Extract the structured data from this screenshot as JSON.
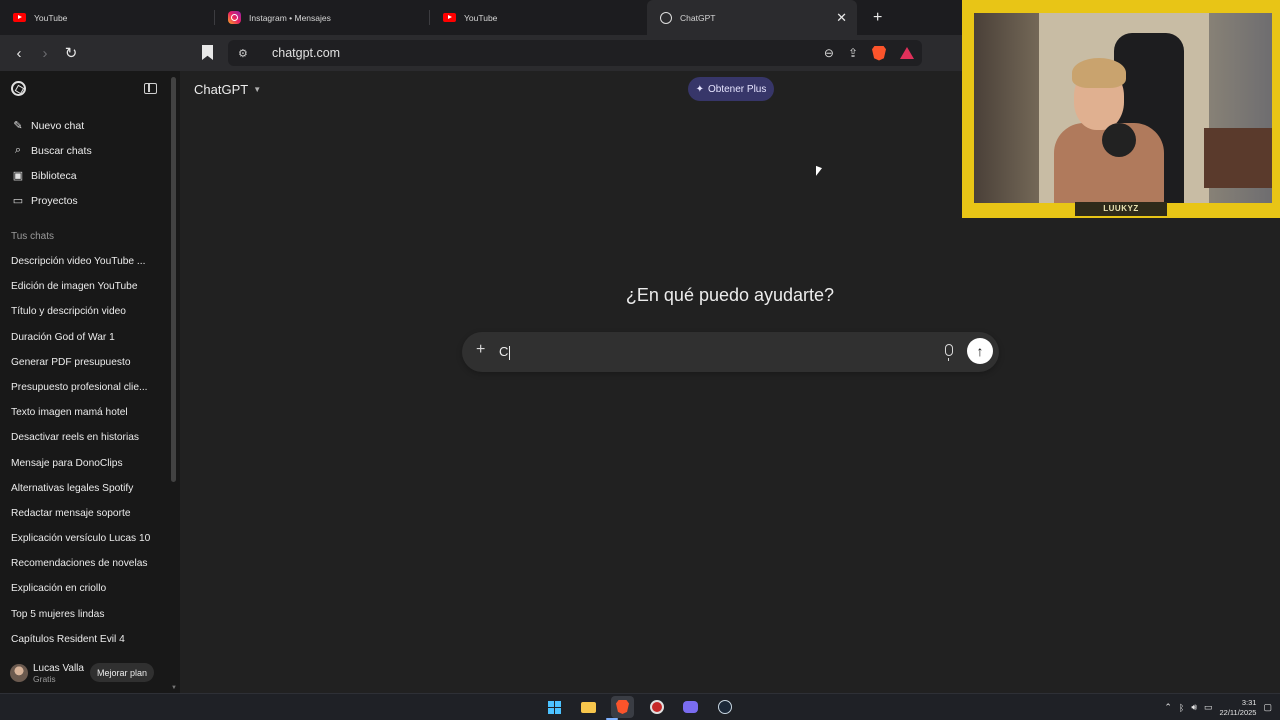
{
  "browser": {
    "tabs": [
      {
        "title": "YouTube",
        "icon": "youtube-icon"
      },
      {
        "title": "Instagram • Mensajes",
        "icon": "instagram-icon"
      },
      {
        "title": "YouTube",
        "icon": "youtube-icon"
      },
      {
        "title": "ChatGPT",
        "icon": "chatgpt-icon",
        "active": true
      }
    ],
    "url": "chatgpt.com"
  },
  "sidebar": {
    "menu": [
      {
        "label": "Nuevo chat",
        "icon": "edit-icon"
      },
      {
        "label": "Buscar chats",
        "icon": "search-icon"
      },
      {
        "label": "Biblioteca",
        "icon": "library-icon"
      },
      {
        "label": "Proyectos",
        "icon": "folder-icon"
      }
    ],
    "section_title": "Tus chats",
    "chats": [
      "Descripción video YouTube ...",
      "Edición de imagen YouTube",
      "Título y descripción video",
      "Duración God of War 1",
      "Generar PDF presupuesto",
      "Presupuesto profesional clie...",
      "Texto imagen mamá hotel",
      "Desactivar reels en historias",
      "Mensaje para DonoClips",
      "Alternativas legales Spotify",
      "Redactar mensaje soporte",
      "Explicación versículo Lucas 10",
      "Recomendaciones de novelas",
      "Explicación en criollo",
      "Top 5 mujeres lindas",
      "Capítulos Resident Evil 4"
    ],
    "user": {
      "name": "Lucas Valla",
      "plan": "Gratis",
      "upgrade_label": "Mejorar plan"
    }
  },
  "main": {
    "model_label": "ChatGPT",
    "plus_label": "Obtener Plus",
    "headline": "¿En qué puedo ayudarte?",
    "composer_text": "C"
  },
  "webcam": {
    "label": "LUUKYZ"
  },
  "taskbar": {
    "time": "3:31",
    "date": "22/11/2025"
  },
  "colors": {
    "plus_button": "#373669",
    "webcam_border": "#e8c516",
    "sidebar_bg": "#181818",
    "main_bg": "#212121"
  }
}
